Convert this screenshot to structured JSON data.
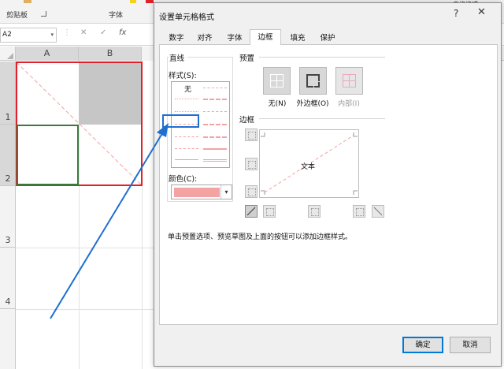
{
  "ribbon": {
    "clipboard_label": "剪贴板",
    "font_label": "字体",
    "right_clip_text": "表格格式"
  },
  "formula_bar": {
    "name_box": "A2",
    "cancel_glyph": "✕",
    "confirm_glyph": "✓",
    "fx_glyph": "fx"
  },
  "sheet": {
    "columns": [
      "A",
      "B"
    ],
    "rows": [
      "1",
      "2",
      "3",
      "4"
    ]
  },
  "dialog": {
    "title": "设置单元格格式",
    "help": "?",
    "close": "✕",
    "tabs": [
      "数字",
      "对齐",
      "字体",
      "边框",
      "填充",
      "保护"
    ],
    "active_tab": "边框",
    "line_group": {
      "title": "直线",
      "style_label": "样式(S):",
      "none_option": "无",
      "color_label": "颜色(C):",
      "color_value": "#f4a3a3"
    },
    "presets": {
      "title": "预置",
      "items": [
        "无(N)",
        "外边框(O)",
        "内部(I)"
      ]
    },
    "border": {
      "title": "边框",
      "preview_text": "文本"
    },
    "hint": "单击预置选项、预览草图及上面的按钮可以添加边框样式。",
    "ok_label": "确定",
    "cancel_label": "取消"
  },
  "colors": {
    "selection_red": "#e0202a",
    "annotation_blue": "#1e6fd0",
    "diagonal_pink": "#f4a3a3"
  }
}
